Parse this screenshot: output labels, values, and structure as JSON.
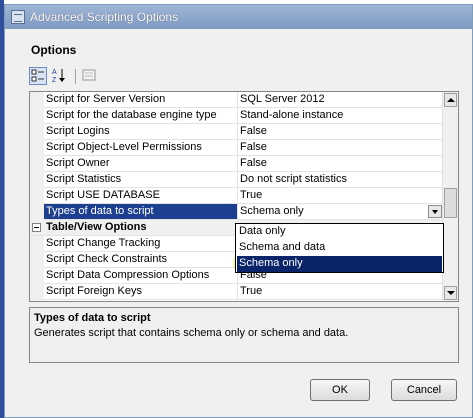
{
  "window": {
    "title": "Advanced Scripting Options"
  },
  "section": {
    "title": "Options"
  },
  "toolbar": {
    "buttons": [
      {
        "icon": "categorized-icon",
        "active": true
      },
      {
        "icon": "alphabetical-sort-icon",
        "active": false
      },
      {
        "icon": "property-pages-icon",
        "active": false
      }
    ]
  },
  "grid": {
    "rows": [
      {
        "name": "Script for Server Version",
        "value": "SQL Server 2012"
      },
      {
        "name": "Script for the database engine type",
        "value": "Stand-alone instance"
      },
      {
        "name": "Script Logins",
        "value": "False"
      },
      {
        "name": "Script Object-Level Permissions",
        "value": "False"
      },
      {
        "name": "Script Owner",
        "value": "False"
      },
      {
        "name": "Script Statistics",
        "value": "Do not script statistics"
      },
      {
        "name": "Script USE DATABASE",
        "value": "True"
      },
      {
        "name": "Types of data to script",
        "value": "Schema only"
      }
    ],
    "category": {
      "name": "Table/View Options"
    },
    "rows2": [
      {
        "name": "Script Change Tracking",
        "value": ""
      },
      {
        "name": "Script Check Constraints",
        "value": ""
      },
      {
        "name": "Script Data Compression Options",
        "value": "False"
      },
      {
        "name": "Script Foreign Keys",
        "value": "True"
      }
    ]
  },
  "dropdown": {
    "options": [
      "Data only",
      "Schema and data",
      "Schema only"
    ],
    "selected": "Schema only"
  },
  "description": {
    "title": "Types of data to script",
    "text": "Generates script that contains schema only or schema and data."
  },
  "buttons": {
    "ok": "OK",
    "cancel": "Cancel"
  },
  "colors": {
    "selection": "#0a246a",
    "title_bar": "#8aa5cc",
    "highlight": "#e8f83c"
  }
}
